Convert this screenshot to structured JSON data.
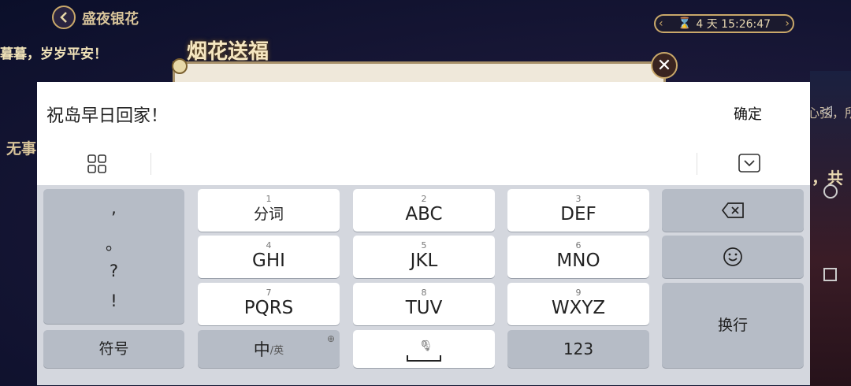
{
  "game": {
    "title": "盛夜银花",
    "timer_text": "4 天 15:26:47",
    "scroll_text_top": "暮暮，岁岁平安！",
    "scroll_text_mid": "无事",
    "panel_title": "烟花送福",
    "right_text_1": "心弦，所",
    "right_text_2": "，共"
  },
  "ime": {
    "input_value": "祝岛早日回家！",
    "confirm_label": "确定",
    "punctuation": [
      ",",
      "。",
      "?",
      "!"
    ],
    "keys": {
      "r1": [
        {
          "num": "1",
          "label": "分词"
        },
        {
          "num": "2",
          "label": "ABC"
        },
        {
          "num": "3",
          "label": "DEF"
        }
      ],
      "r2": [
        {
          "num": "4",
          "label": "GHI"
        },
        {
          "num": "5",
          "label": "JKL"
        },
        {
          "num": "6",
          "label": "MNO"
        }
      ],
      "r3": [
        {
          "num": "7",
          "label": "PQRS"
        },
        {
          "num": "8",
          "label": "TUV"
        },
        {
          "num": "9",
          "label": "WXYZ"
        }
      ]
    },
    "symbol_label": "符号",
    "lang_main": "中",
    "lang_sub": "/英",
    "space_num": "0",
    "num_label": "123",
    "newline_label": "换行"
  },
  "icons": {
    "back": "chevron-left-icon",
    "hourglass": "hourglass-icon",
    "close": "close-icon",
    "grid": "grid-icon",
    "hide_keyboard": "keyboard-hide-icon",
    "backspace": "backspace-icon",
    "emoji": "emoji-icon",
    "globe": "globe-icon",
    "mic": "microphone-icon"
  },
  "colors": {
    "keyboard_bg": "#d4d7de",
    "key_light": "#ffffff",
    "key_dark": "#b6bcc6",
    "gold": "#c9a86a"
  }
}
